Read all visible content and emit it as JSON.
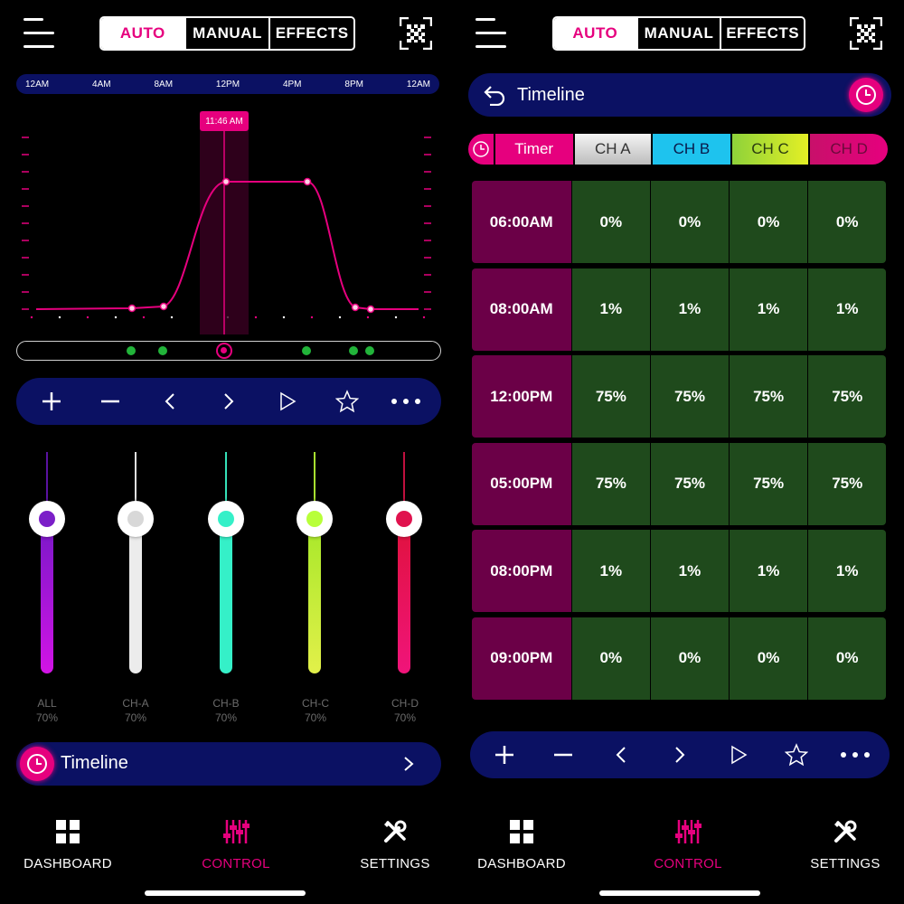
{
  "header": {
    "tabs": [
      "AUTO",
      "MANUAL",
      "EFFECTS"
    ],
    "active_tab": "AUTO"
  },
  "left": {
    "time_axis": [
      "12AM",
      "4AM",
      "8AM",
      "12PM",
      "4PM",
      "8PM",
      "12AM"
    ],
    "current_time": "11:46 AM",
    "channels": [
      {
        "name": "ALL",
        "value": "70%",
        "color": "#7b1fc8",
        "bar": "#c41ee0"
      },
      {
        "name": "CH-A",
        "value": "70%",
        "color": "#d8d8d8",
        "bar": "#e8e8e8"
      },
      {
        "name": "CH-B",
        "value": "70%",
        "color": "#35f0c8",
        "bar": "#35f0c8"
      },
      {
        "name": "CH-C",
        "value": "70%",
        "color": "#b8ff3a",
        "bar": "#c8f23a"
      },
      {
        "name": "CH-D",
        "value": "70%",
        "color": "#e0124e",
        "bar": "#e01460"
      }
    ],
    "timeline_label": "Timeline"
  },
  "right": {
    "title": "Timeline",
    "columns": [
      "Timer",
      "CH A",
      "CH B",
      "CH C",
      "CH D"
    ],
    "rows": [
      {
        "time": "06:00AM",
        "values": [
          "0%",
          "0%",
          "0%",
          "0%"
        ]
      },
      {
        "time": "08:00AM",
        "values": [
          "1%",
          "1%",
          "1%",
          "1%"
        ]
      },
      {
        "time": "12:00PM",
        "values": [
          "75%",
          "75%",
          "75%",
          "75%"
        ]
      },
      {
        "time": "05:00PM",
        "values": [
          "75%",
          "75%",
          "75%",
          "75%"
        ]
      },
      {
        "time": "08:00PM",
        "values": [
          "1%",
          "1%",
          "1%",
          "1%"
        ]
      },
      {
        "time": "09:00PM",
        "values": [
          "0%",
          "0%",
          "0%",
          "0%"
        ]
      }
    ]
  },
  "nav": [
    {
      "label": "DASHBOARD",
      "icon": "grid-icon"
    },
    {
      "label": "CONTROL",
      "icon": "sliders-icon"
    },
    {
      "label": "SETTINGS",
      "icon": "tools-icon"
    }
  ],
  "active_nav": "CONTROL",
  "colors": {
    "accent": "#e6007e",
    "bar_bg": "#0b1163",
    "timer_cell": "#6b0047",
    "value_cell": "#1f4a1c"
  }
}
